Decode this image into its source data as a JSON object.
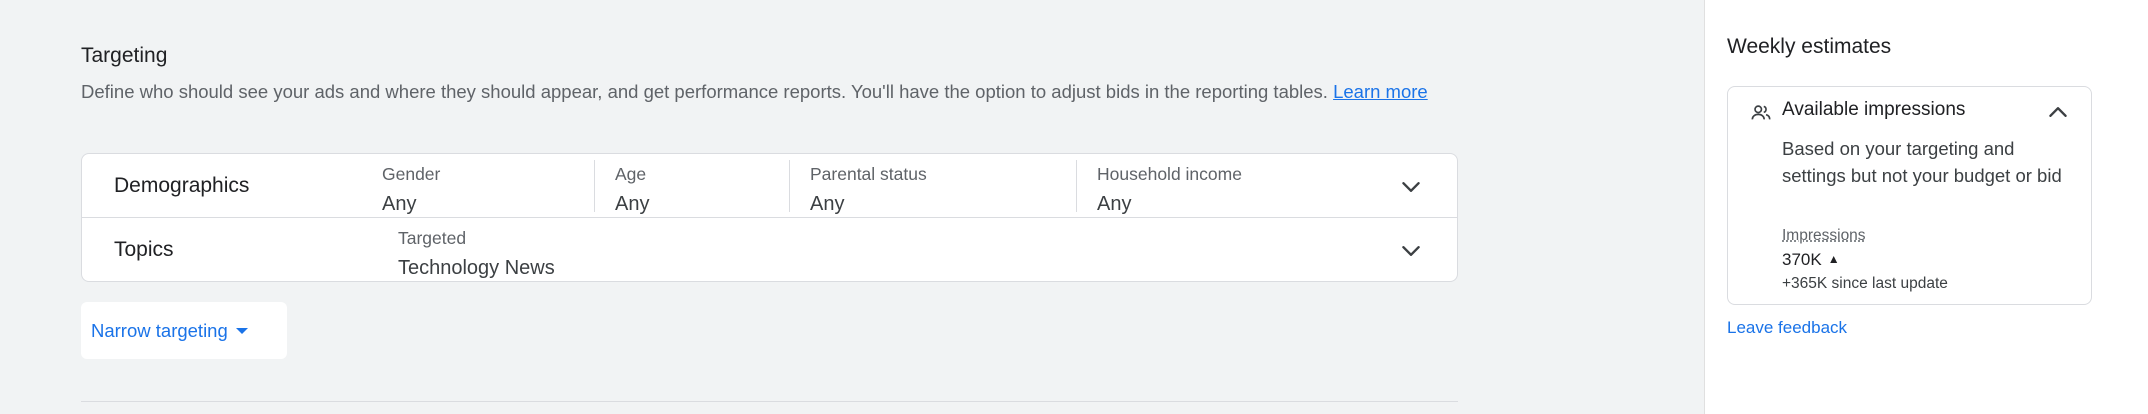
{
  "targeting": {
    "title": "Targeting",
    "description": "Define who should see your ads and where they should appear, and get performance reports. You'll have the option to adjust bids in the reporting tables.",
    "learn_more": "Learn more",
    "demographics": {
      "label": "Demographics",
      "gender_label": "Gender",
      "gender_value": "Any",
      "age_label": "Age",
      "age_value": "Any",
      "parental_label": "Parental status",
      "parental_value": "Any",
      "income_label": "Household income",
      "income_value": "Any"
    },
    "topics": {
      "label": "Topics",
      "targeted_label": "Targeted",
      "targeted_value": "Technology News"
    },
    "narrow_label": "Narrow targeting"
  },
  "sidebar": {
    "title": "Weekly estimates",
    "impressions_title": "Available impressions",
    "impressions_desc": "Based on your targeting and settings but not your budget or bid",
    "impressions_label": "Impressions",
    "impressions_value": "370K",
    "impressions_since": "+365K since last update",
    "feedback": "Leave feedback"
  },
  "colors": {
    "accent": "#1a73e8",
    "background": "#f1f3f4"
  },
  "icons": {
    "expand": "chevron-down-icon",
    "collapse": "chevron-up-icon",
    "people": "people-icon",
    "trend": "arrow-up-icon"
  }
}
